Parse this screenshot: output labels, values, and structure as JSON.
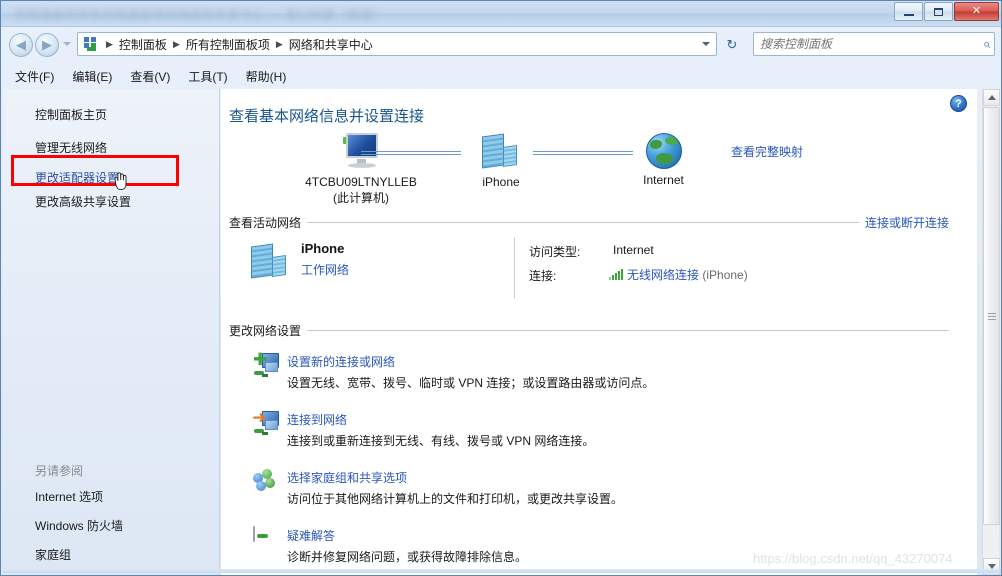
{
  "window": {
    "title_blurred": "控制面板的所有控制面板项的网络和共享中心 — 窗口标题（模糊）",
    "controls": {
      "minimize": "–",
      "maximize": "❐",
      "close": "✕"
    }
  },
  "addressbar": {
    "back_icon": "◀",
    "forward_icon": "▶",
    "icon_name": "control-panel-icon",
    "breadcrumbs": [
      "控制面板",
      "所有控制面板项",
      "网络和共享中心"
    ],
    "separator": "▶",
    "refresh_icon": "↻"
  },
  "search": {
    "placeholder": "搜索控制面板",
    "value": "",
    "icon": "search-icon"
  },
  "menubar": {
    "items": [
      "文件(F)",
      "编辑(E)",
      "查看(V)",
      "工具(T)",
      "帮助(H)"
    ]
  },
  "sidebar": {
    "items": [
      {
        "label": "控制面板主页",
        "style": "plain"
      },
      {
        "label": "管理无线网络",
        "style": "plain"
      },
      {
        "label": "更改适配器设置",
        "style": "link-underline"
      },
      {
        "label": "更改高级共享设置",
        "style": "plain"
      }
    ],
    "see_also_header": "另请参阅",
    "see_also": [
      "Internet 选项",
      "Windows 防火墙",
      "家庭组"
    ]
  },
  "content": {
    "help_glyph": "?",
    "page_title": "查看基本网络信息并设置连接",
    "full_map_link": "查看完整映射",
    "network_map": {
      "nodes": [
        {
          "name": "4TCBU09LTNYLLEB",
          "sub": "(此计算机)",
          "icon": "computer-monitor-icon"
        },
        {
          "name": "iPhone",
          "sub": "",
          "icon": "network-server-icon"
        },
        {
          "name": "Internet",
          "sub": "",
          "icon": "globe-icon"
        }
      ]
    },
    "active_networks": {
      "header": "查看活动网络",
      "link": "连接或断开连接",
      "network": {
        "name": "iPhone",
        "type": "工作网络",
        "icon": "network-server-icon",
        "access_key": "访问类型:",
        "access_value": "Internet",
        "connection_key": "连接:",
        "connection_link": "无线网络连接",
        "connection_suffix": "(iPhone)",
        "signal_icon": "wifi-signal-icon"
      }
    },
    "change_settings": {
      "header": "更改网络设置",
      "options": [
        {
          "title": "设置新的连接或网络",
          "desc": "设置无线、宽带、拨号、临时或 VPN 连接；或设置路由器或访问点。",
          "icon": "new-connection-icon"
        },
        {
          "title": "连接到网络",
          "desc": "连接到或重新连接到无线、有线、拨号或 VPN 网络连接。",
          "icon": "connect-network-icon"
        },
        {
          "title": "选择家庭组和共享选项",
          "desc": "访问位于其他网络计算机上的文件和打印机，或更改共享设置。",
          "icon": "homegroup-icon"
        },
        {
          "title": "疑难解答",
          "desc": "诊断并修复网络问题，或获得故障排除信息。",
          "icon": "troubleshoot-icon"
        }
      ]
    }
  },
  "watermark": {
    "text": "https://blog.csdn.net/qq_43270074"
  },
  "annotation": {
    "highlight_color": "#ff0000",
    "target": "更改适配器设置"
  },
  "scrollbar": {
    "up": "▲",
    "down": "▼"
  }
}
